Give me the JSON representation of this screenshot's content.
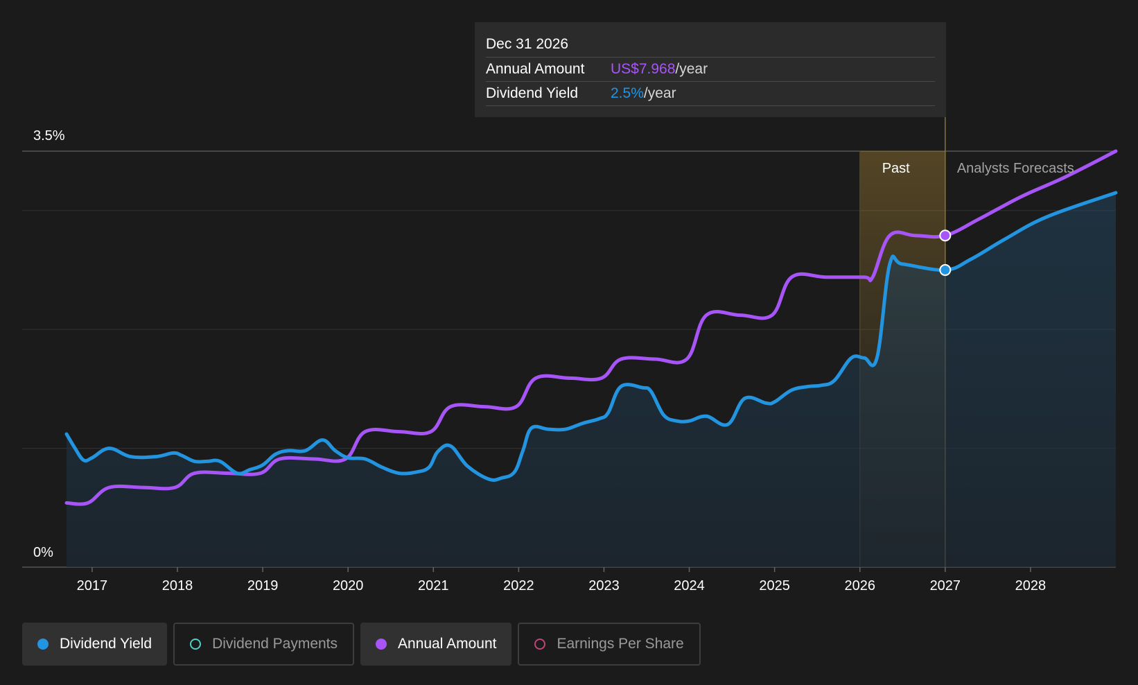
{
  "tooltip": {
    "date": "Dec 31 2026",
    "annual_label": "Annual Amount",
    "annual_value": "US$7.968",
    "annual_unit": "/year",
    "yield_label": "Dividend Yield",
    "yield_value": "2.5%",
    "yield_unit": "/year"
  },
  "legend": [
    {
      "label": "Dividend Yield",
      "active": true,
      "color": "#2394df"
    },
    {
      "label": "Dividend Payments",
      "active": false,
      "color": "#4fd1c5"
    },
    {
      "label": "Annual Amount",
      "active": true,
      "color": "#a855f7"
    },
    {
      "label": "Earnings Per Share",
      "active": false,
      "color": "#c2457a"
    }
  ],
  "chart_data": {
    "type": "line",
    "xlim": [
      2016.7,
      2029.0
    ],
    "ylim": [
      0,
      3.5
    ],
    "y_tick_labels": [
      {
        "value": 3.5,
        "label": "3.5%"
      },
      {
        "value": 0,
        "label": "0%"
      }
    ],
    "gridlines_y": [
      0,
      1,
      2,
      3,
      3.5
    ],
    "x_ticks": [
      2017,
      2018,
      2019,
      2020,
      2021,
      2022,
      2023,
      2024,
      2025,
      2026,
      2027,
      2028
    ],
    "past_region": {
      "from": 2026.0,
      "to": 2027.0,
      "label": "Past"
    },
    "forecast_label": "Analysts Forecasts",
    "highlight_x": 2027.0,
    "series": [
      {
        "name": "Dividend Yield",
        "color": "#2394df",
        "fill": true,
        "points": [
          [
            2016.7,
            1.12
          ],
          [
            2016.8,
            1.0
          ],
          [
            2016.9,
            0.9
          ],
          [
            2017.0,
            0.92
          ],
          [
            2017.2,
            1.0
          ],
          [
            2017.45,
            0.93
          ],
          [
            2017.75,
            0.93
          ],
          [
            2017.95,
            0.96
          ],
          [
            2018.05,
            0.94
          ],
          [
            2018.2,
            0.89
          ],
          [
            2018.35,
            0.89
          ],
          [
            2018.5,
            0.89
          ],
          [
            2018.7,
            0.79
          ],
          [
            2018.85,
            0.82
          ],
          [
            2019.0,
            0.86
          ],
          [
            2019.15,
            0.95
          ],
          [
            2019.3,
            0.98
          ],
          [
            2019.5,
            0.98
          ],
          [
            2019.7,
            1.07
          ],
          [
            2019.85,
            0.98
          ],
          [
            2020.0,
            0.92
          ],
          [
            2020.2,
            0.91
          ],
          [
            2020.4,
            0.84
          ],
          [
            2020.6,
            0.79
          ],
          [
            2020.8,
            0.8
          ],
          [
            2020.95,
            0.84
          ],
          [
            2021.05,
            0.97
          ],
          [
            2021.2,
            1.02
          ],
          [
            2021.4,
            0.85
          ],
          [
            2021.65,
            0.74
          ],
          [
            2021.8,
            0.75
          ],
          [
            2021.95,
            0.8
          ],
          [
            2022.05,
            0.98
          ],
          [
            2022.15,
            1.17
          ],
          [
            2022.35,
            1.16
          ],
          [
            2022.55,
            1.16
          ],
          [
            2022.75,
            1.21
          ],
          [
            2022.95,
            1.25
          ],
          [
            2023.05,
            1.3
          ],
          [
            2023.2,
            1.52
          ],
          [
            2023.45,
            1.51
          ],
          [
            2023.55,
            1.48
          ],
          [
            2023.7,
            1.28
          ],
          [
            2023.85,
            1.23
          ],
          [
            2024.0,
            1.23
          ],
          [
            2024.2,
            1.27
          ],
          [
            2024.45,
            1.2
          ],
          [
            2024.65,
            1.42
          ],
          [
            2024.9,
            1.38
          ],
          [
            2025.0,
            1.39
          ],
          [
            2025.2,
            1.49
          ],
          [
            2025.4,
            1.52
          ],
          [
            2025.55,
            1.53
          ],
          [
            2025.7,
            1.57
          ],
          [
            2025.9,
            1.76
          ],
          [
            2026.05,
            1.76
          ],
          [
            2026.2,
            1.76
          ],
          [
            2026.35,
            2.55
          ],
          [
            2026.5,
            2.55
          ],
          [
            2027.0,
            2.5
          ],
          [
            2027.3,
            2.59
          ],
          [
            2027.7,
            2.76
          ],
          [
            2028.2,
            2.95
          ],
          [
            2029.0,
            3.15
          ]
        ]
      },
      {
        "name": "Annual Amount",
        "color": "#a855f7",
        "fill": false,
        "points": [
          [
            2016.7,
            0.54
          ],
          [
            2016.95,
            0.54
          ],
          [
            2017.2,
            0.67
          ],
          [
            2017.6,
            0.67
          ],
          [
            2017.97,
            0.67
          ],
          [
            2018.2,
            0.79
          ],
          [
            2018.6,
            0.79
          ],
          [
            2018.97,
            0.79
          ],
          [
            2019.2,
            0.91
          ],
          [
            2019.6,
            0.91
          ],
          [
            2019.97,
            0.91
          ],
          [
            2020.2,
            1.14
          ],
          [
            2020.6,
            1.14
          ],
          [
            2020.97,
            1.14
          ],
          [
            2021.2,
            1.35
          ],
          [
            2021.6,
            1.35
          ],
          [
            2021.97,
            1.35
          ],
          [
            2022.2,
            1.59
          ],
          [
            2022.6,
            1.59
          ],
          [
            2022.97,
            1.59
          ],
          [
            2023.2,
            1.75
          ],
          [
            2023.6,
            1.75
          ],
          [
            2023.97,
            1.75
          ],
          [
            2024.2,
            2.12
          ],
          [
            2024.6,
            2.12
          ],
          [
            2024.97,
            2.12
          ],
          [
            2025.2,
            2.44
          ],
          [
            2025.6,
            2.44
          ],
          [
            2026.05,
            2.44
          ],
          [
            2026.15,
            2.44
          ],
          [
            2026.35,
            2.79
          ],
          [
            2026.65,
            2.79
          ],
          [
            2027.0,
            2.79
          ],
          [
            2027.4,
            2.93
          ],
          [
            2027.9,
            3.12
          ],
          [
            2028.4,
            3.28
          ],
          [
            2029.0,
            3.5
          ]
        ]
      }
    ],
    "markers": [
      {
        "series": "Annual Amount",
        "x": 2027.0,
        "y": 2.79
      },
      {
        "series": "Dividend Yield",
        "x": 2027.0,
        "y": 2.5
      }
    ]
  }
}
